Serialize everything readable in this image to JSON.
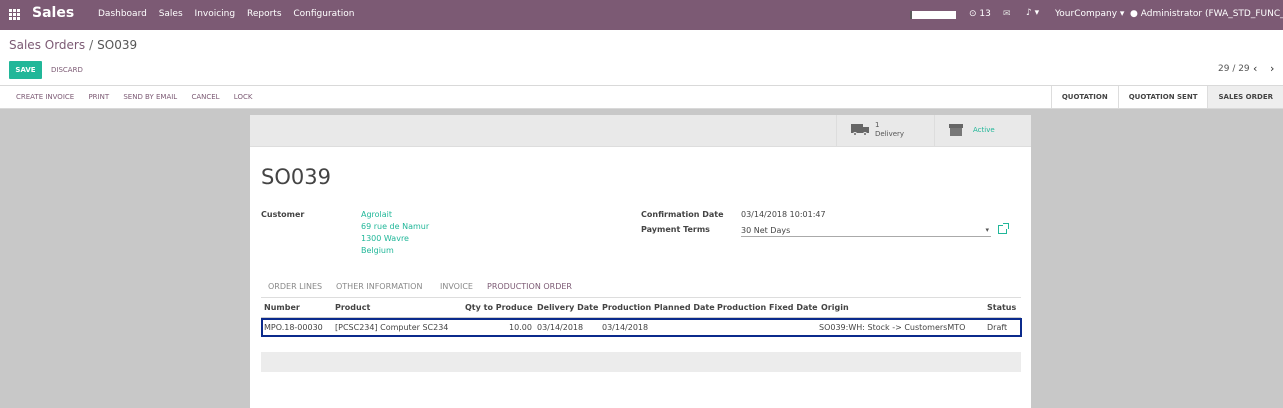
{
  "navbar": {
    "app_name": "Sales",
    "menu": [
      "Dashboard",
      "Sales",
      "Invoicing",
      "Reports",
      "Configuration"
    ],
    "progress_fraction": 0.05,
    "message_count": "13",
    "company": "YourCompany",
    "user": "Administrator (FWA_STD_FUNC_VT)"
  },
  "breadcrumb": {
    "parent": "Sales Orders",
    "separator": "/",
    "current": "SO039"
  },
  "buttons": {
    "save": "SAVE",
    "discard": "DISCARD"
  },
  "pager": {
    "text": "29 / 29",
    "prev": "‹",
    "next": "›"
  },
  "actions": [
    "CREATE INVOICE",
    "PRINT",
    "SEND BY EMAIL",
    "CANCEL",
    "LOCK"
  ],
  "stages": [
    {
      "label": "QUOTATION",
      "active": false
    },
    {
      "label": "QUOTATION SENT",
      "active": false
    },
    {
      "label": "SALES ORDER",
      "active": true
    }
  ],
  "smart_buttons": {
    "delivery_count": "1",
    "delivery_label": "Delivery",
    "active_label": "Active"
  },
  "form": {
    "title": "SO039",
    "customer_label": "Customer",
    "customer_lines": [
      "Agrolait",
      "69 rue de Namur",
      "1300 Wavre",
      "Belgium"
    ],
    "confirmation_label": "Confirmation Date",
    "confirmation_value": "03/14/2018 10:01:47",
    "terms_label": "Payment Terms",
    "terms_value": "30 Net Days"
  },
  "tabs": [
    "ORDER LINES",
    "OTHER INFORMATION",
    "INVOICE",
    "PRODUCTION ORDER"
  ],
  "active_tab": "PRODUCTION ORDER",
  "production_table": {
    "headers": [
      "Number",
      "Product",
      "Qty to Produce",
      "Delivery Date",
      "Production Planned Date",
      "Production Fixed Date",
      "Origin",
      "Status"
    ],
    "rows": [
      [
        "MPO.18-00030",
        "[PCSC234] Computer SC234",
        "10.00",
        "03/14/2018",
        "03/14/2018",
        "",
        "SO039:WH: Stock -> CustomersMTO",
        "Draft"
      ]
    ]
  },
  "colors": {
    "brand": "#7c5a74",
    "accent": "#21b799",
    "selection_border": "#0b2a8c"
  },
  "icons": [
    "apps-grid-icon",
    "message-icon",
    "chat-icon",
    "bell-icon",
    "user-icon",
    "truck-icon",
    "archive-icon",
    "external-link-icon",
    "caret-down-icon"
  ]
}
